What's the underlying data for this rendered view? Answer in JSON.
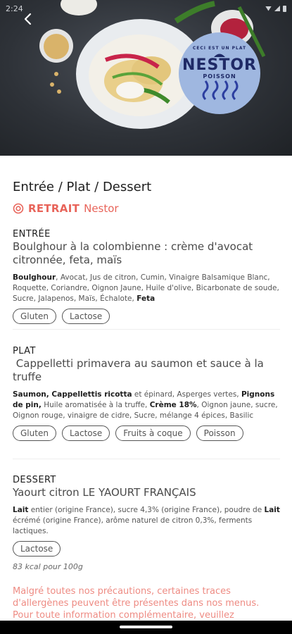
{
  "statusbar": {
    "time": "2:24"
  },
  "hero": {
    "badge": {
      "top_text": "CECI EST UN PLAT",
      "title": "NESTOR",
      "subtitle": "POISSON"
    }
  },
  "page": {
    "title": "Entrée / Plat / Dessert",
    "pickup": {
      "label": "RETRAIT",
      "place": "Nestor"
    }
  },
  "courses": [
    {
      "label": "ENTRÉE",
      "name": "Boulghour à la colombienne : crème d'avocat citronnée, feta, maïs",
      "tags": [
        "Gluten",
        "Lactose"
      ]
    },
    {
      "label": "PLAT",
      "name": " Cappelletti primavera au saumon et sauce à la truffe",
      "tags": [
        "Gluten",
        "Lactose",
        "Fruits à coque",
        "Poisson"
      ]
    },
    {
      "label": "DESSERT",
      "name": "Yaourt citron LE YAOURT FRANÇAIS",
      "tags": [
        "Lactose"
      ],
      "kcal": "83 kcal pour 100g"
    }
  ],
  "ingredients": {
    "entree": {
      "b1": "Boulghour",
      "t1": ", Avocat, Jus de citron, Cumin, Vinaigre Balsamique Blanc, Roquette, Coriandre, Oignon Jaune, Huile d'olive, Bicarbonate de soude, Sucre, Jalapenos, Maïs, Échalote, ",
      "b2": "Feta"
    },
    "plat": {
      "b1": "Saumon, Cappellettis ricotta",
      "t1": " et épinard, Asperges vertes, ",
      "b2": "Pignons de pin,",
      "t2": " Huile aromatisée à la truffe, ",
      "b3": "Crème 18%",
      "t3": ", Oignon jaune, sucre, Oignon rouge, vinaigre de cidre, Sucre, mélange 4 épices, Basilic"
    },
    "dessert": {
      "b1": "Lait",
      "t1": " entier (origine France), sucre 4,3% (origine France), poudre de ",
      "b2": "Lait",
      "t2": " écrémé (origine France), arôme naturel de citron 0,3%, ferments lactiques."
    }
  },
  "notice": "Malgré toutes nos précautions, certaines traces d'allergènes peuvent être présentes dans nos menus. Pour toute information complémentaire, veuillez",
  "colors": {
    "accent": "#e8645a",
    "badge": "#9fb7e0",
    "badge_text": "#1f2a66"
  }
}
